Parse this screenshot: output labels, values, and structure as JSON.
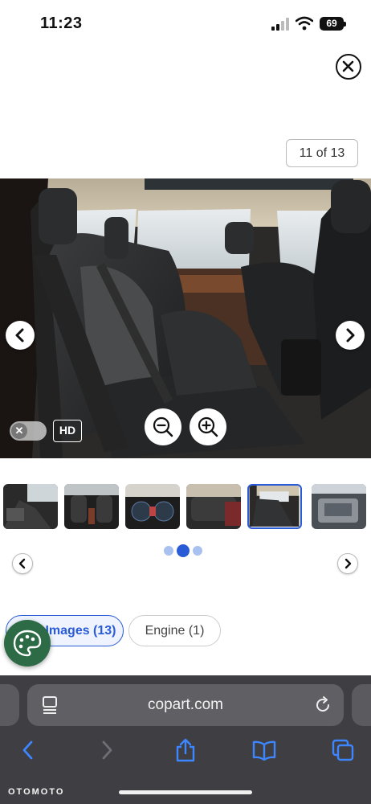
{
  "status_bar": {
    "time": "11:23",
    "battery": "69"
  },
  "viewer": {
    "counter": "11 of 13",
    "hd_label": "HD",
    "toggle_symbol": "✕"
  },
  "thumbnails": [
    {
      "name": "thumb-interior-front",
      "active": false
    },
    {
      "name": "thumb-front-seats",
      "active": false
    },
    {
      "name": "thumb-dashboard",
      "active": false
    },
    {
      "name": "thumb-rear-seats",
      "active": false
    },
    {
      "name": "thumb-rear-seats-side",
      "active": true
    },
    {
      "name": "thumb-engine",
      "active": false
    }
  ],
  "pagination": {
    "pages": 3,
    "current": 2
  },
  "chips": {
    "images": "Images (13)",
    "engine": "Engine (1)"
  },
  "browser": {
    "url": "copart.com"
  },
  "watermark": "OTOMOTO",
  "icons": [
    "close-icon",
    "chevron-left-icon",
    "chevron-right-icon",
    "zoom-out-icon",
    "zoom-in-icon",
    "palette-icon",
    "reader-icon",
    "reload-icon",
    "back-icon",
    "forward-icon",
    "share-icon",
    "bookmarks-icon",
    "tabs-icon"
  ],
  "colors": {
    "accent": "#2a5bd7",
    "fab": "#2c6b45",
    "browser_bg": "#3f3f43"
  }
}
